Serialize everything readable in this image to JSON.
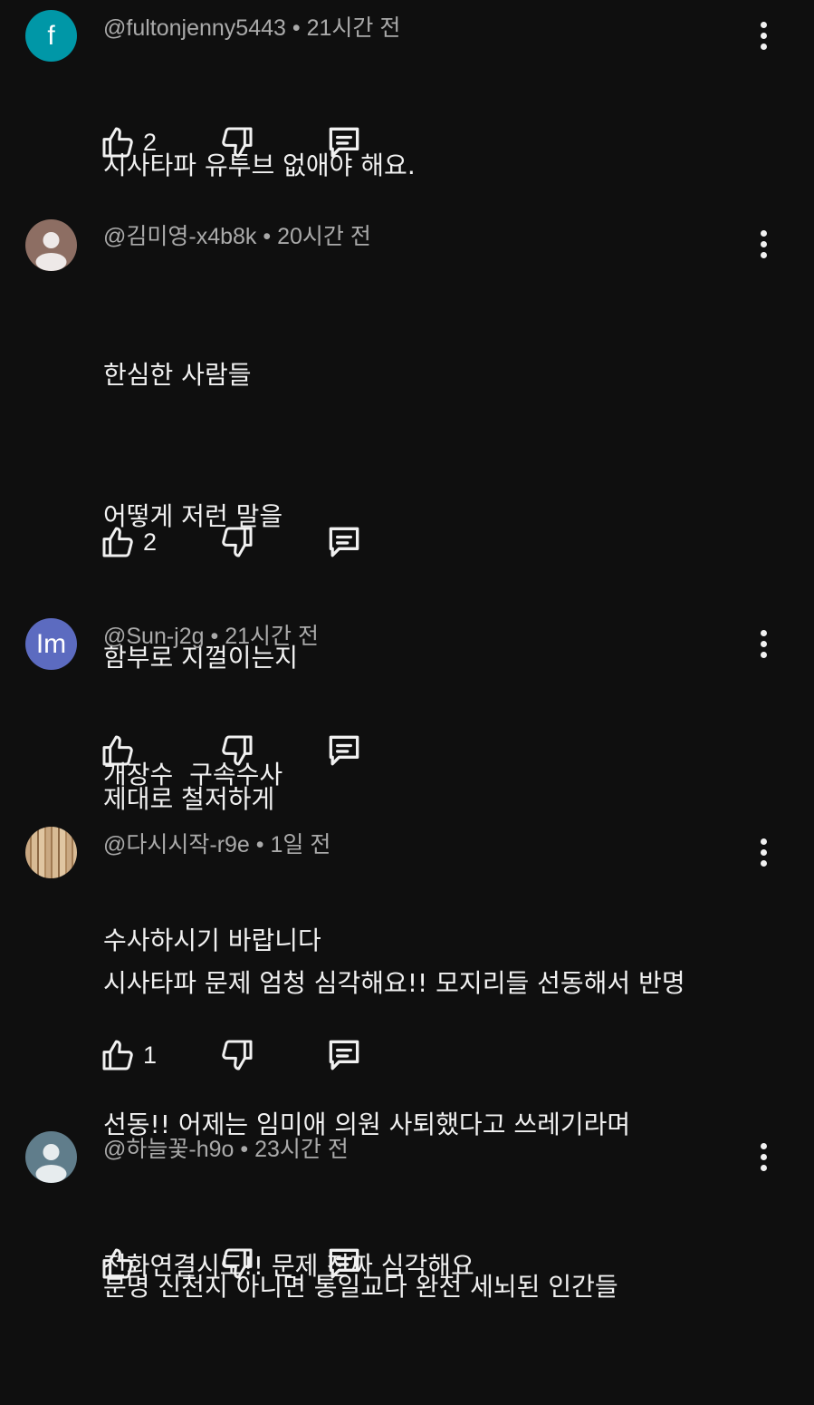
{
  "comments": [
    {
      "handle": "@fultonjenny5443",
      "time": "21시간 전",
      "avatar_letter": "f",
      "avatar_color": "#0097a7",
      "lines": [
        "시사타파 유투브 없애야 해요."
      ],
      "likes": "2"
    },
    {
      "handle": "@김미영-x4b8k",
      "time": "20시간 전",
      "avatar_letter": "",
      "avatar_color": "#8d6e63",
      "lines": [
        "한심한 사람들",
        "어떻게 저런 말을",
        "함부로 지껄이는지",
        "제대로 철저하게",
        "수사하시기 바랍니다"
      ],
      "likes": "2"
    },
    {
      "handle": "@Sun-j2g",
      "time": "21시간 전",
      "avatar_letter": "Im",
      "avatar_color": "#5c6bc0",
      "lines": [
        "개장수  구속수사"
      ],
      "likes": ""
    },
    {
      "handle": "@다시시작-r9e",
      "time": "1일 전",
      "avatar_letter": "",
      "avatar_color": "#c9a882",
      "lines": [
        "시사타파 문제 엄청 심각해요!! 모지리들 선동해서 반명",
        "선동!! 어제는 임미애 의원 사퇴했다고 쓰레기라며",
        "전화연결시도!! 문제 진짜 심각해요"
      ],
      "likes": "1"
    },
    {
      "handle": "@하늘꽃-h9o",
      "time": "23시간 전",
      "avatar_letter": "",
      "avatar_color": "#607d8b",
      "lines": [
        "분명 신천지 아니면 통일교다 완전 세뇌된 인간들"
      ],
      "likes": ""
    }
  ],
  "meta_separator": " • "
}
